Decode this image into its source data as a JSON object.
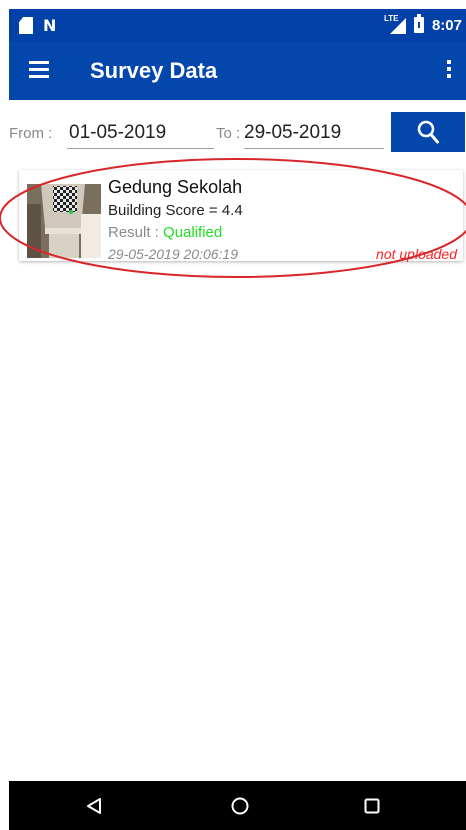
{
  "status_bar": {
    "time": "8:07",
    "network_label": "LTE"
  },
  "app_bar": {
    "title": "Survey Data"
  },
  "filter": {
    "from_label": "From :",
    "from_value": "01-05-2019",
    "to_label": "To :",
    "to_value": "29-05-2019"
  },
  "items": [
    {
      "title": "Gedung Sekolah",
      "score": "Building Score = 4.4",
      "result_label": "Result : ",
      "result_value": "Qualified",
      "timestamp": "29-05-2019 20:06:19",
      "upload_status": "not uploaded"
    }
  ],
  "colors": {
    "primary": "#0347ad",
    "status_bar": "#0242a8",
    "qualified": "#22dd22",
    "not_uploaded": "#ff2222",
    "annotation": "#d8262a"
  },
  "icons": {
    "status_left": [
      "sd-card-icon",
      "nfc-icon"
    ],
    "status_right": [
      "lte-signal-icon",
      "battery-icon"
    ],
    "app_bar": [
      "menu-icon",
      "more-vert-icon"
    ],
    "search": "search-icon",
    "nav": [
      "back-icon",
      "home-icon",
      "recents-icon"
    ]
  }
}
